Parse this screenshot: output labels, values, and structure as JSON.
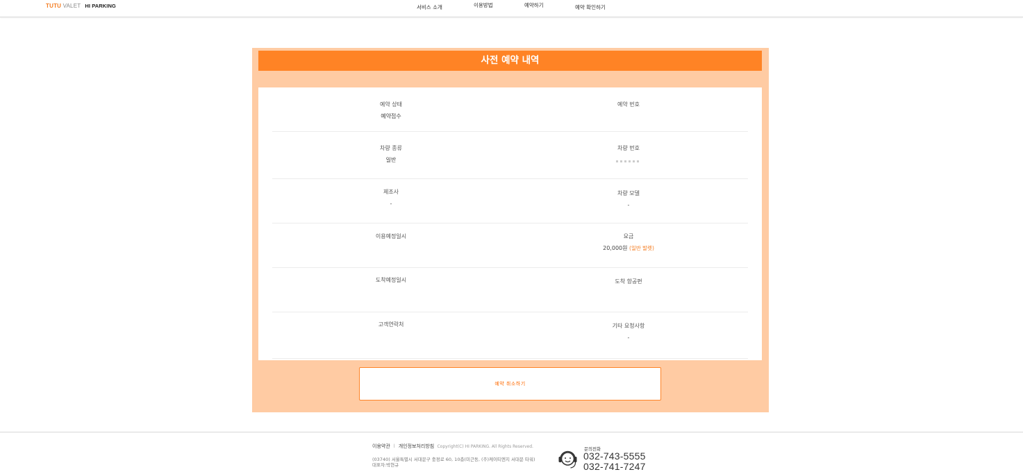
{
  "header": {
    "logo_turu": "TUTU",
    "logo_valet": "VALET",
    "logo_hiparking": "HI PARKING",
    "nav": [
      "서비스 소개",
      "이용방법",
      "예약하기",
      "예약 확인하기"
    ]
  },
  "card": {
    "title": "사전 예약 내역",
    "rows": [
      {
        "left_label": "예약 상태",
        "left_value": "예약접수",
        "right_label": "예약 번호",
        "right_value": ""
      },
      {
        "left_label": "차량 종류",
        "left_value": "일반",
        "right_label": "차량 번호",
        "right_value": ""
      },
      {
        "left_label": "제조사",
        "left_value": "-",
        "right_label": "차량 모델",
        "right_value": "-"
      },
      {
        "left_label": "이용예정일시",
        "left_value": "",
        "right_label": "요금",
        "right_value": "20,000원",
        "right_note": "(일반 발렛)"
      },
      {
        "left_label": "도착예정일시",
        "left_value": "",
        "right_label": "도착 항공편",
        "right_value": ""
      },
      {
        "left_label": "고객연락처",
        "left_value": "",
        "right_label": "기타 요청사항",
        "right_value": "-"
      }
    ],
    "cancel_button": "예약 취소하기"
  },
  "footer": {
    "terms": "이용약관",
    "separator": "l",
    "privacy": "개인정보처리방침",
    "copyright": "Copyright(C) HI PARKING. All Rights Reserved.",
    "address_line1": "(03740) 서울특별시 서대문구 충정로 60, 10층(미근동, (주)케이티엔지 서대문 타워)",
    "address_line2": "대표자:박현규",
    "inquiry_label": "문의전화",
    "phones": [
      "032-743-5555",
      "032-741-7247"
    ]
  },
  "colors": {
    "accent": "#ff8325",
    "card_bg": "#ffcba3",
    "note": "#f47c20"
  }
}
